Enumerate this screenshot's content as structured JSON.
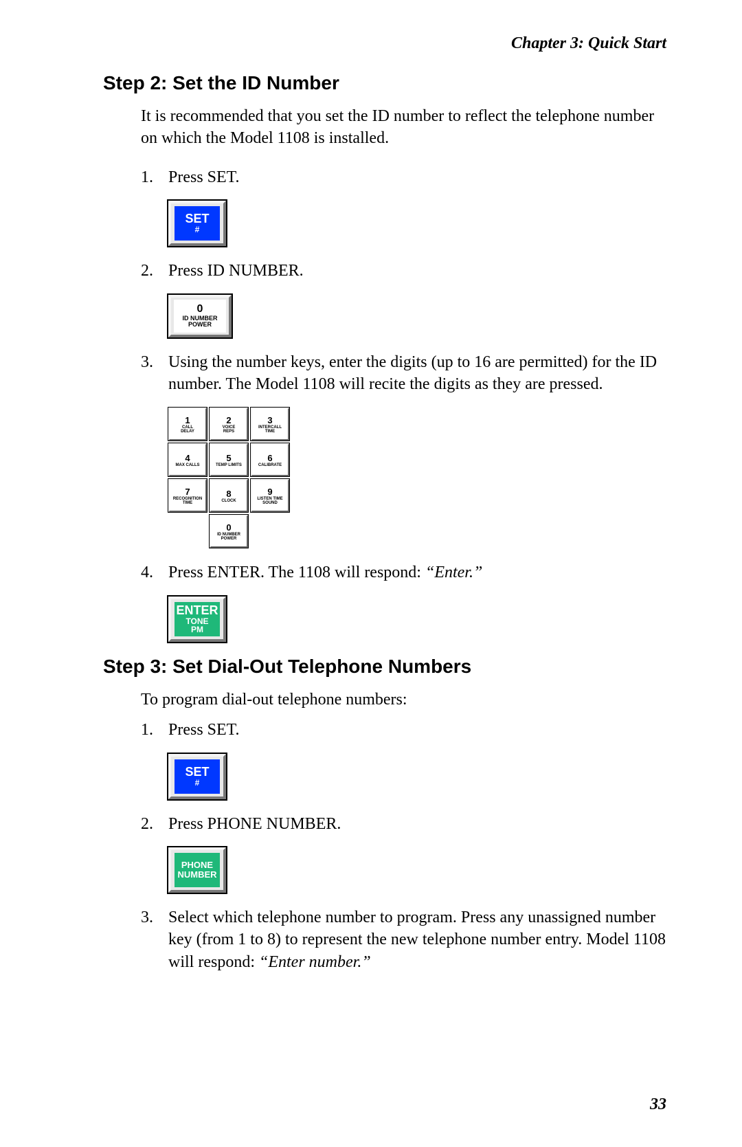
{
  "chapter_header": "Chapter 3: Quick Start",
  "page_number": "33",
  "step2": {
    "heading": "Step 2:  Set the ID Number",
    "intro": "It is recommended that you set the ID number to reflect the telephone number on which the Model 1108 is installed.",
    "items": {
      "i1": {
        "num": "1.",
        "text": "Press SET."
      },
      "i2": {
        "num": "2.",
        "text": "Press ID NUMBER."
      },
      "i3": {
        "num": "3.",
        "text": "Using the number keys, enter the digits (up to 16 are permitted) for the ID number. The Model 1108 will recite the digits as they are pressed."
      },
      "i4": {
        "num": "4.",
        "pre": "Press ENTER. The 1108 will respond: ",
        "quote": "“Enter.”"
      }
    }
  },
  "step3": {
    "heading": "Step 3:  Set Dial-Out Telephone Numbers",
    "intro": "To program dial-out telephone numbers:",
    "items": {
      "i1": {
        "num": "1.",
        "text": "Press SET."
      },
      "i2": {
        "num": "2.",
        "text": "Press PHONE NUMBER."
      },
      "i3": {
        "num": "3.",
        "pre": "Select which telephone number to program. Press any unassigned number key (from 1 to 8) to represent the new telephone number entry. Model 1108 will respond: ",
        "quote": "“Enter number.”"
      }
    }
  },
  "keys": {
    "set": {
      "line1": "SET",
      "line2": "#"
    },
    "id": {
      "digit": "0",
      "sub1": "ID NUMBER",
      "sub2": "POWER"
    },
    "enter": {
      "line1": "ENTER",
      "line2": "TONE",
      "line3": "PM"
    },
    "phone": {
      "line1": "PHONE",
      "line2": "NUMBER"
    }
  },
  "keypad": [
    {
      "d": "1",
      "s1": "CALL",
      "s2": "DELAY"
    },
    {
      "d": "2",
      "s1": "VOICE",
      "s2": "REPS"
    },
    {
      "d": "3",
      "s1": "INTERCALL",
      "s2": "TIME"
    },
    {
      "d": "4",
      "s1": "MAX CALLS",
      "s2": ""
    },
    {
      "d": "5",
      "s1": "TEMP LIMITS",
      "s2": ""
    },
    {
      "d": "6",
      "s1": "CALIBRATE",
      "s2": ""
    },
    {
      "d": "7",
      "s1": "RECOGNITION",
      "s2": "TIME"
    },
    {
      "d": "8",
      "s1": "CLOCK",
      "s2": ""
    },
    {
      "d": "9",
      "s1": "LISTEN TIME",
      "s2": "SOUND"
    },
    {
      "d": "0",
      "s1": "ID NUMBER",
      "s2": "POWER"
    }
  ]
}
